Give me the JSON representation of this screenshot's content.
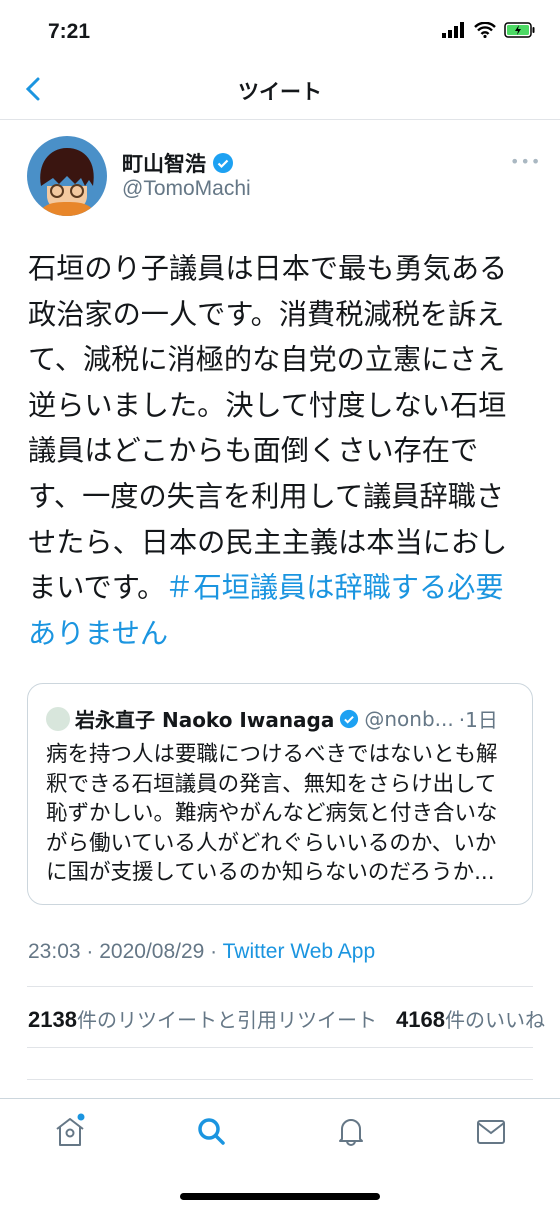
{
  "status_bar": {
    "time": "7:21"
  },
  "nav": {
    "title": "ツイート",
    "back_icon": "chevron-left-icon"
  },
  "tweet": {
    "author_name": "町山智浩",
    "author_handle": "@TomoMachi",
    "verified": true,
    "body": "石垣のり子議員は日本で最も勇気ある政治家の一人です。消費税減税を訴えて、減税に消極的な自党の立憲にさえ逆らいました。決して忖度しない石垣議員はどこからも面倒くさい存在です、一度の失言を利用して議員辞職させたら、日本の民主主義は本当におしまいです。",
    "hashtag": "＃石垣議員は辞職する必要ありません",
    "time": "23:03",
    "date": "2020/08/29",
    "source": "Twitter Web App",
    "separator": " · ",
    "retweets_count": "2138",
    "retweets_label": "件のリツイートと引用リツイート",
    "likes_count": "4168",
    "likes_label": "件のいいね"
  },
  "quoted": {
    "name": "岩永直子 Naoko Iwanaga",
    "handle": "@nonb...",
    "age": "·1日",
    "verified": true,
    "text": "病を持つ人は要職につけるべきではないとも解釈できる石垣議員の発言、無知をさらけ出して恥ずかしい。難病やがんなど病気と付き合いながら働いている人がどれぐらいいるのか、いかに国が支援しているのか知らないのだろうか..."
  },
  "tabbar": {
    "items": [
      "home-icon",
      "search-icon",
      "notifications-icon",
      "messages-icon"
    ],
    "active": "search-icon"
  },
  "colors": {
    "accent": "#1b95e0",
    "secondary_text": "#657786"
  }
}
